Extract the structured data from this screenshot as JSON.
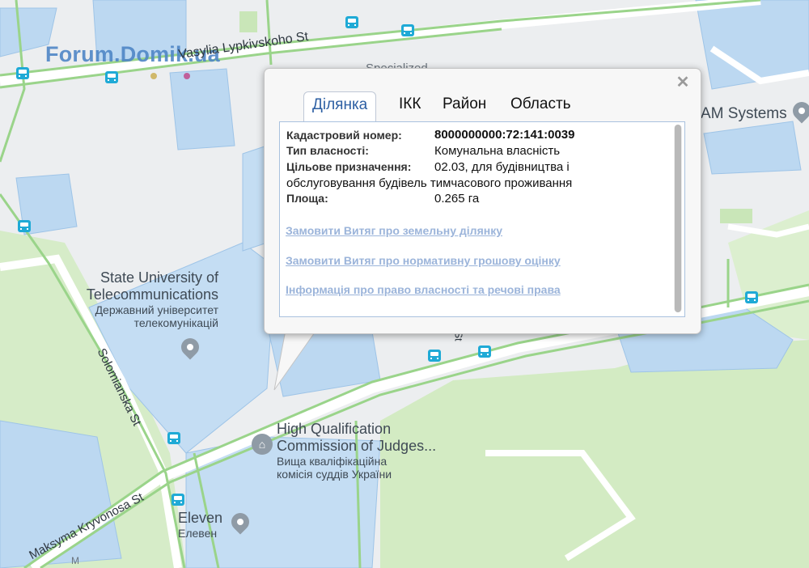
{
  "watermark": "Forum.Domik.ua",
  "streets": {
    "vasylia": "Vasylia Lypkivskoho St",
    "solomianska": "Solomianska St",
    "kryvonosa": "Maksyma Kryvonosa St",
    "specialized": "Specialized",
    "st_fragment": "St",
    "am_systems": "AM Systems",
    "m_fragment": "M"
  },
  "places": {
    "university": {
      "en_line1": "State University of",
      "en_line2": "Telecommunications",
      "uk_line1": "Державний університет",
      "uk_line2": "телекомунікацій",
      "icon": "graduation-cap-icon"
    },
    "commission": {
      "en_line1": "High Qualification",
      "en_line2": "Commission of Judges...",
      "uk_line1": "Вища кваліфікаційна",
      "uk_line2": "комісія суддів України",
      "icon": "courthouse-icon"
    },
    "eleven": {
      "en": "Eleven",
      "uk": "Елевен",
      "icon": "map-pin-icon"
    }
  },
  "popup": {
    "close_glyph": "✕",
    "tabs": [
      {
        "label": "Ділянка",
        "active": true
      },
      {
        "label": "ІКК",
        "active": false
      },
      {
        "label": "Район",
        "active": false
      },
      {
        "label": "Область",
        "active": false
      }
    ],
    "fields": {
      "cadastral_label": "Кадастровий номер:",
      "cadastral_value": "8000000000:72:141:0039",
      "ownership_label": "Тип власності:",
      "ownership_value": "Комунальна власність",
      "purpose_label": "Цільове призначення:",
      "purpose_value_line1": "02.03, для будівництва і",
      "purpose_value_line2": "обслуговування будівель тимчасового проживання",
      "area_label": "Площа:",
      "area_value": "0.265 га"
    },
    "links": [
      "Замовити Витяг про земельну ділянку",
      "Замовити Витяг про нормативну грошову оцінку",
      "Інформація про право власності та речові права"
    ]
  },
  "colors": {
    "road_green": "#9ad48a",
    "parcel_blue": "#b8d6f2",
    "park_green": "#cfe9bd",
    "link": "#9bb4da",
    "bus": "#1faad6"
  }
}
